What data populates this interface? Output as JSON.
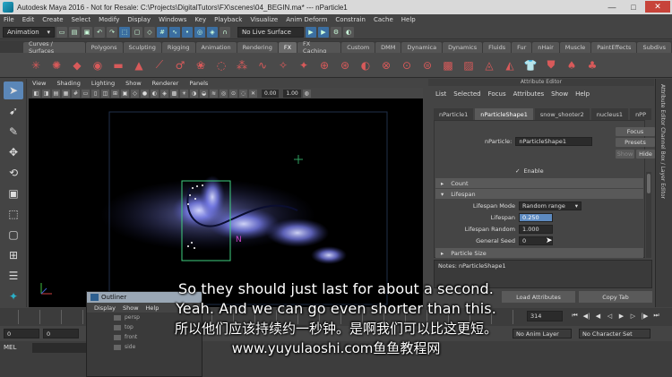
{
  "window": {
    "title": "Autodesk Maya 2016 - Not for Resale: C:\\Projects\\DigitalTutors\\FX\\scenes\\04_BEGIN.ma*  ---  nParticle1",
    "minimize": "—",
    "maximize": "□",
    "close": "✕"
  },
  "menubar": [
    "File",
    "Edit",
    "Create",
    "Select",
    "Modify",
    "Display",
    "Windows",
    "Key",
    "Playback",
    "Visualize",
    "Anim Deform",
    "Constrain",
    "Cache",
    "Help"
  ],
  "statusline": {
    "mode": "Animation",
    "live_surface": "No Live Surface"
  },
  "shelf_tabs": [
    "Curves / Surfaces",
    "Polygons",
    "Sculpting",
    "Rigging",
    "Animation",
    "Rendering",
    "FX",
    "FX Caching",
    "Custom",
    "DMM",
    "Dynamica",
    "Dynamics",
    "Fluids",
    "Fur",
    "nHair",
    "Muscle",
    "PaintEffects",
    "Subdivs"
  ],
  "shelf_active": "FX",
  "panel": {
    "menu": [
      "View",
      "Shading",
      "Lighting",
      "Show",
      "Renderer",
      "Panels"
    ],
    "near": "0.00",
    "far": "1.00"
  },
  "attribute_editor": {
    "header": "Attribute Editor",
    "menu": [
      "List",
      "Selected",
      "Focus",
      "Attributes",
      "Show",
      "Help"
    ],
    "tabs": [
      "nParticle1",
      "nParticleShape1",
      "snow_shooter2",
      "nucleus1",
      "nPP"
    ],
    "active_tab": "nParticleShape1",
    "node_label": "nParticle:",
    "node_value": "nParticleShape1",
    "focus": "Focus",
    "presets": "Presets",
    "show": "Show",
    "hide": "Hide",
    "enable_label": "Enable",
    "sections": {
      "count": "Count",
      "lifespan": "Lifespan",
      "particle_size": "Particle Size"
    },
    "lifespan_mode_label": "Lifespan Mode",
    "lifespan_mode_value": "Random range",
    "lifespan_label": "Lifespan",
    "lifespan_value": "0.250",
    "lifespan_random_label": "Lifespan Random",
    "lifespan_random_value": "1.000",
    "general_seed_label": "General Seed",
    "general_seed_value": "0",
    "notes_label": "Notes:  nParticleShape1",
    "load_attributes": "Load Attributes",
    "copy_tab": "Copy Tab"
  },
  "right_strip_label": "Attribute Editor   Channel Box / Layer Editor",
  "timeline": {
    "current_frame": "314",
    "range_start": "0",
    "range_start_b": "0",
    "anim_layer": "No Anim Layer",
    "character_set": "No Character Set"
  },
  "command_line_label": "MEL",
  "outliner": {
    "title": "Outliner",
    "menu": [
      "Display",
      "Show",
      "Help"
    ],
    "items": [
      "persp",
      "top",
      "front",
      "side"
    ]
  },
  "viewport": {
    "nparticle_label": "N"
  },
  "subtitles": {
    "line1": "So they should just last for about a second.",
    "line2": "Yeah. And we can go even shorter than this.",
    "line3": "所以他们应该持续约一秒钟。是啊我们可以比这更短。",
    "line4": "www.yuyulaoshi.com鱼鱼教程网"
  },
  "colors": {
    "accent": "#5d8ac0",
    "particle": "#7a80f0",
    "selection": "#40d080",
    "emitter": "#cc44cc"
  }
}
